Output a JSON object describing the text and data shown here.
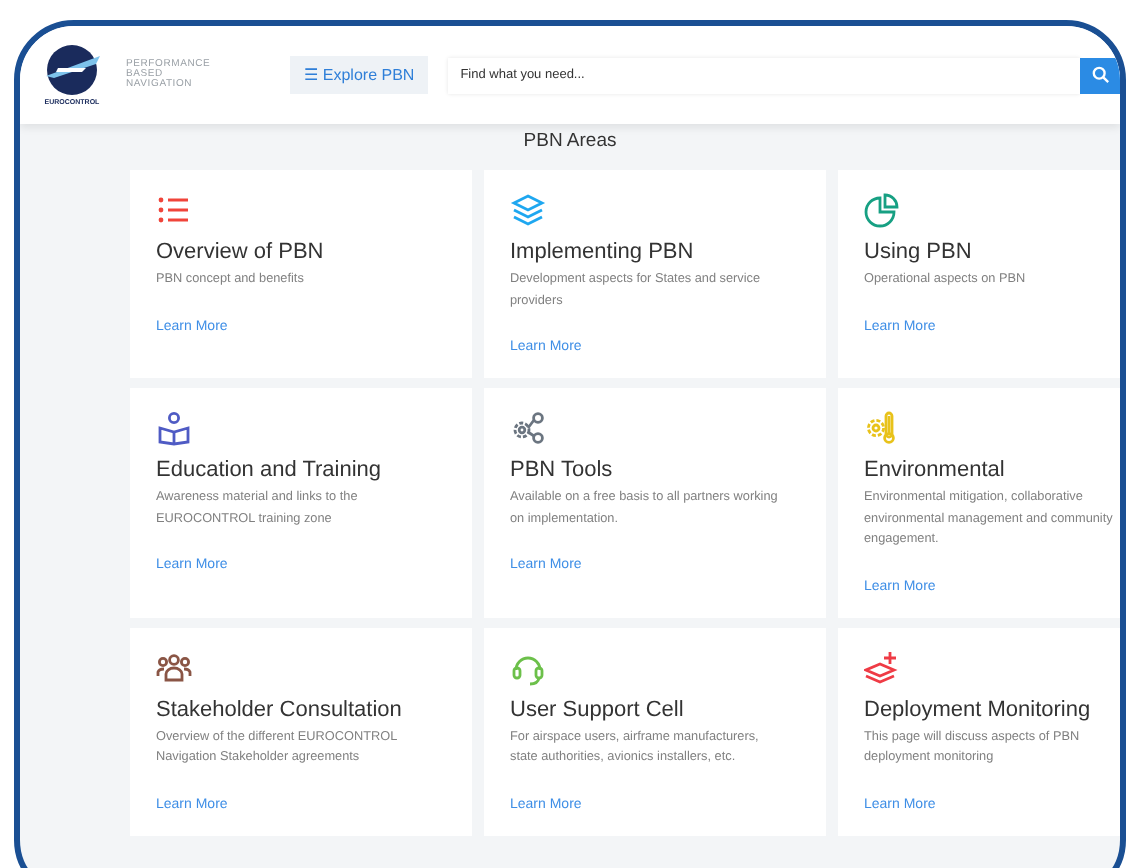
{
  "header": {
    "logo_text": "EUROCONTROL",
    "tagline": [
      "PERFORMANCE",
      "BASED",
      "NAVIGATION"
    ],
    "explore_button": {
      "icon": "☰",
      "label": "Explore PBN"
    },
    "search": {
      "placeholder": "Find what you need..."
    }
  },
  "section_title": "PBN Areas",
  "cards": [
    {
      "kind": "list",
      "title": "Overview of PBN",
      "description": "PBN concept and benefits",
      "link": "Learn More"
    },
    {
      "kind": "layers",
      "title": "Implementing PBN",
      "description": "Development aspects for States and service providers",
      "link": "Learn More"
    },
    {
      "kind": "pie",
      "title": "Using PBN",
      "description": "Operational aspects on PBN",
      "link": "Learn More"
    },
    {
      "kind": "reader",
      "title": "Education and Training",
      "description": "Awareness material and links to the EUROCONTROL training zone",
      "link": "Learn More"
    },
    {
      "kind": "gears",
      "title": "PBN Tools",
      "description": "Available on a free basis to all partners working on implementation.",
      "link": "Learn More"
    },
    {
      "kind": "thermo",
      "title": "Environmental",
      "description": "Environmental mitigation, collaborative environmental management and community engagement.",
      "link": "Learn More"
    },
    {
      "kind": "people",
      "title": "Stakeholder Consultation",
      "description": "Overview of the different EUROCONTROL Navigation Stakeholder agreements",
      "link": "Learn More"
    },
    {
      "kind": "headset",
      "title": "User Support Cell",
      "description": "For airspace users, airframe manufacturers, state authorities, avionics installers, etc.",
      "link": "Learn More"
    },
    {
      "kind": "stackplus",
      "title": "Deployment Monitoring",
      "description": "This page will discuss aspects of PBN deployment monitoring",
      "link": "Learn More"
    }
  ]
}
